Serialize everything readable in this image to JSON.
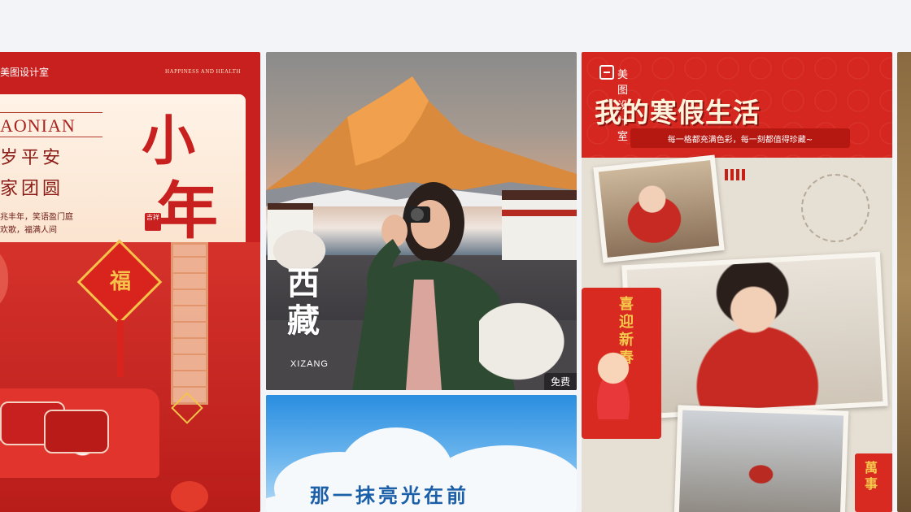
{
  "cards": [
    {
      "brand": "美图设计室",
      "tagline": "HAPPINESS AND HEALTH",
      "pinyin": "AONIAN",
      "line1": "岁平安",
      "line2": "家团圆",
      "small1": "兆丰年，笑语盈门庭",
      "small2": "欢歌，福满人间",
      "big1": "小",
      "big2": "年",
      "seal": "吉祥",
      "fu": "福"
    },
    {
      "title1": "西",
      "title2": "藏",
      "subtitle": "XIZANG",
      "badge": "免费"
    },
    {
      "text": "那一抹亮光在前"
    },
    {
      "brand": "美图设计室",
      "title": "我的寒假生活",
      "ribbon": "每一格都充满色彩，每一刻都值得珍藏~",
      "card_text": "喜迎新春",
      "card2_text": "萬事"
    }
  ],
  "colors": {
    "festive_red": "#c8201e",
    "gold": "#f5c24a",
    "sky_blue": "#2a8ee0"
  }
}
